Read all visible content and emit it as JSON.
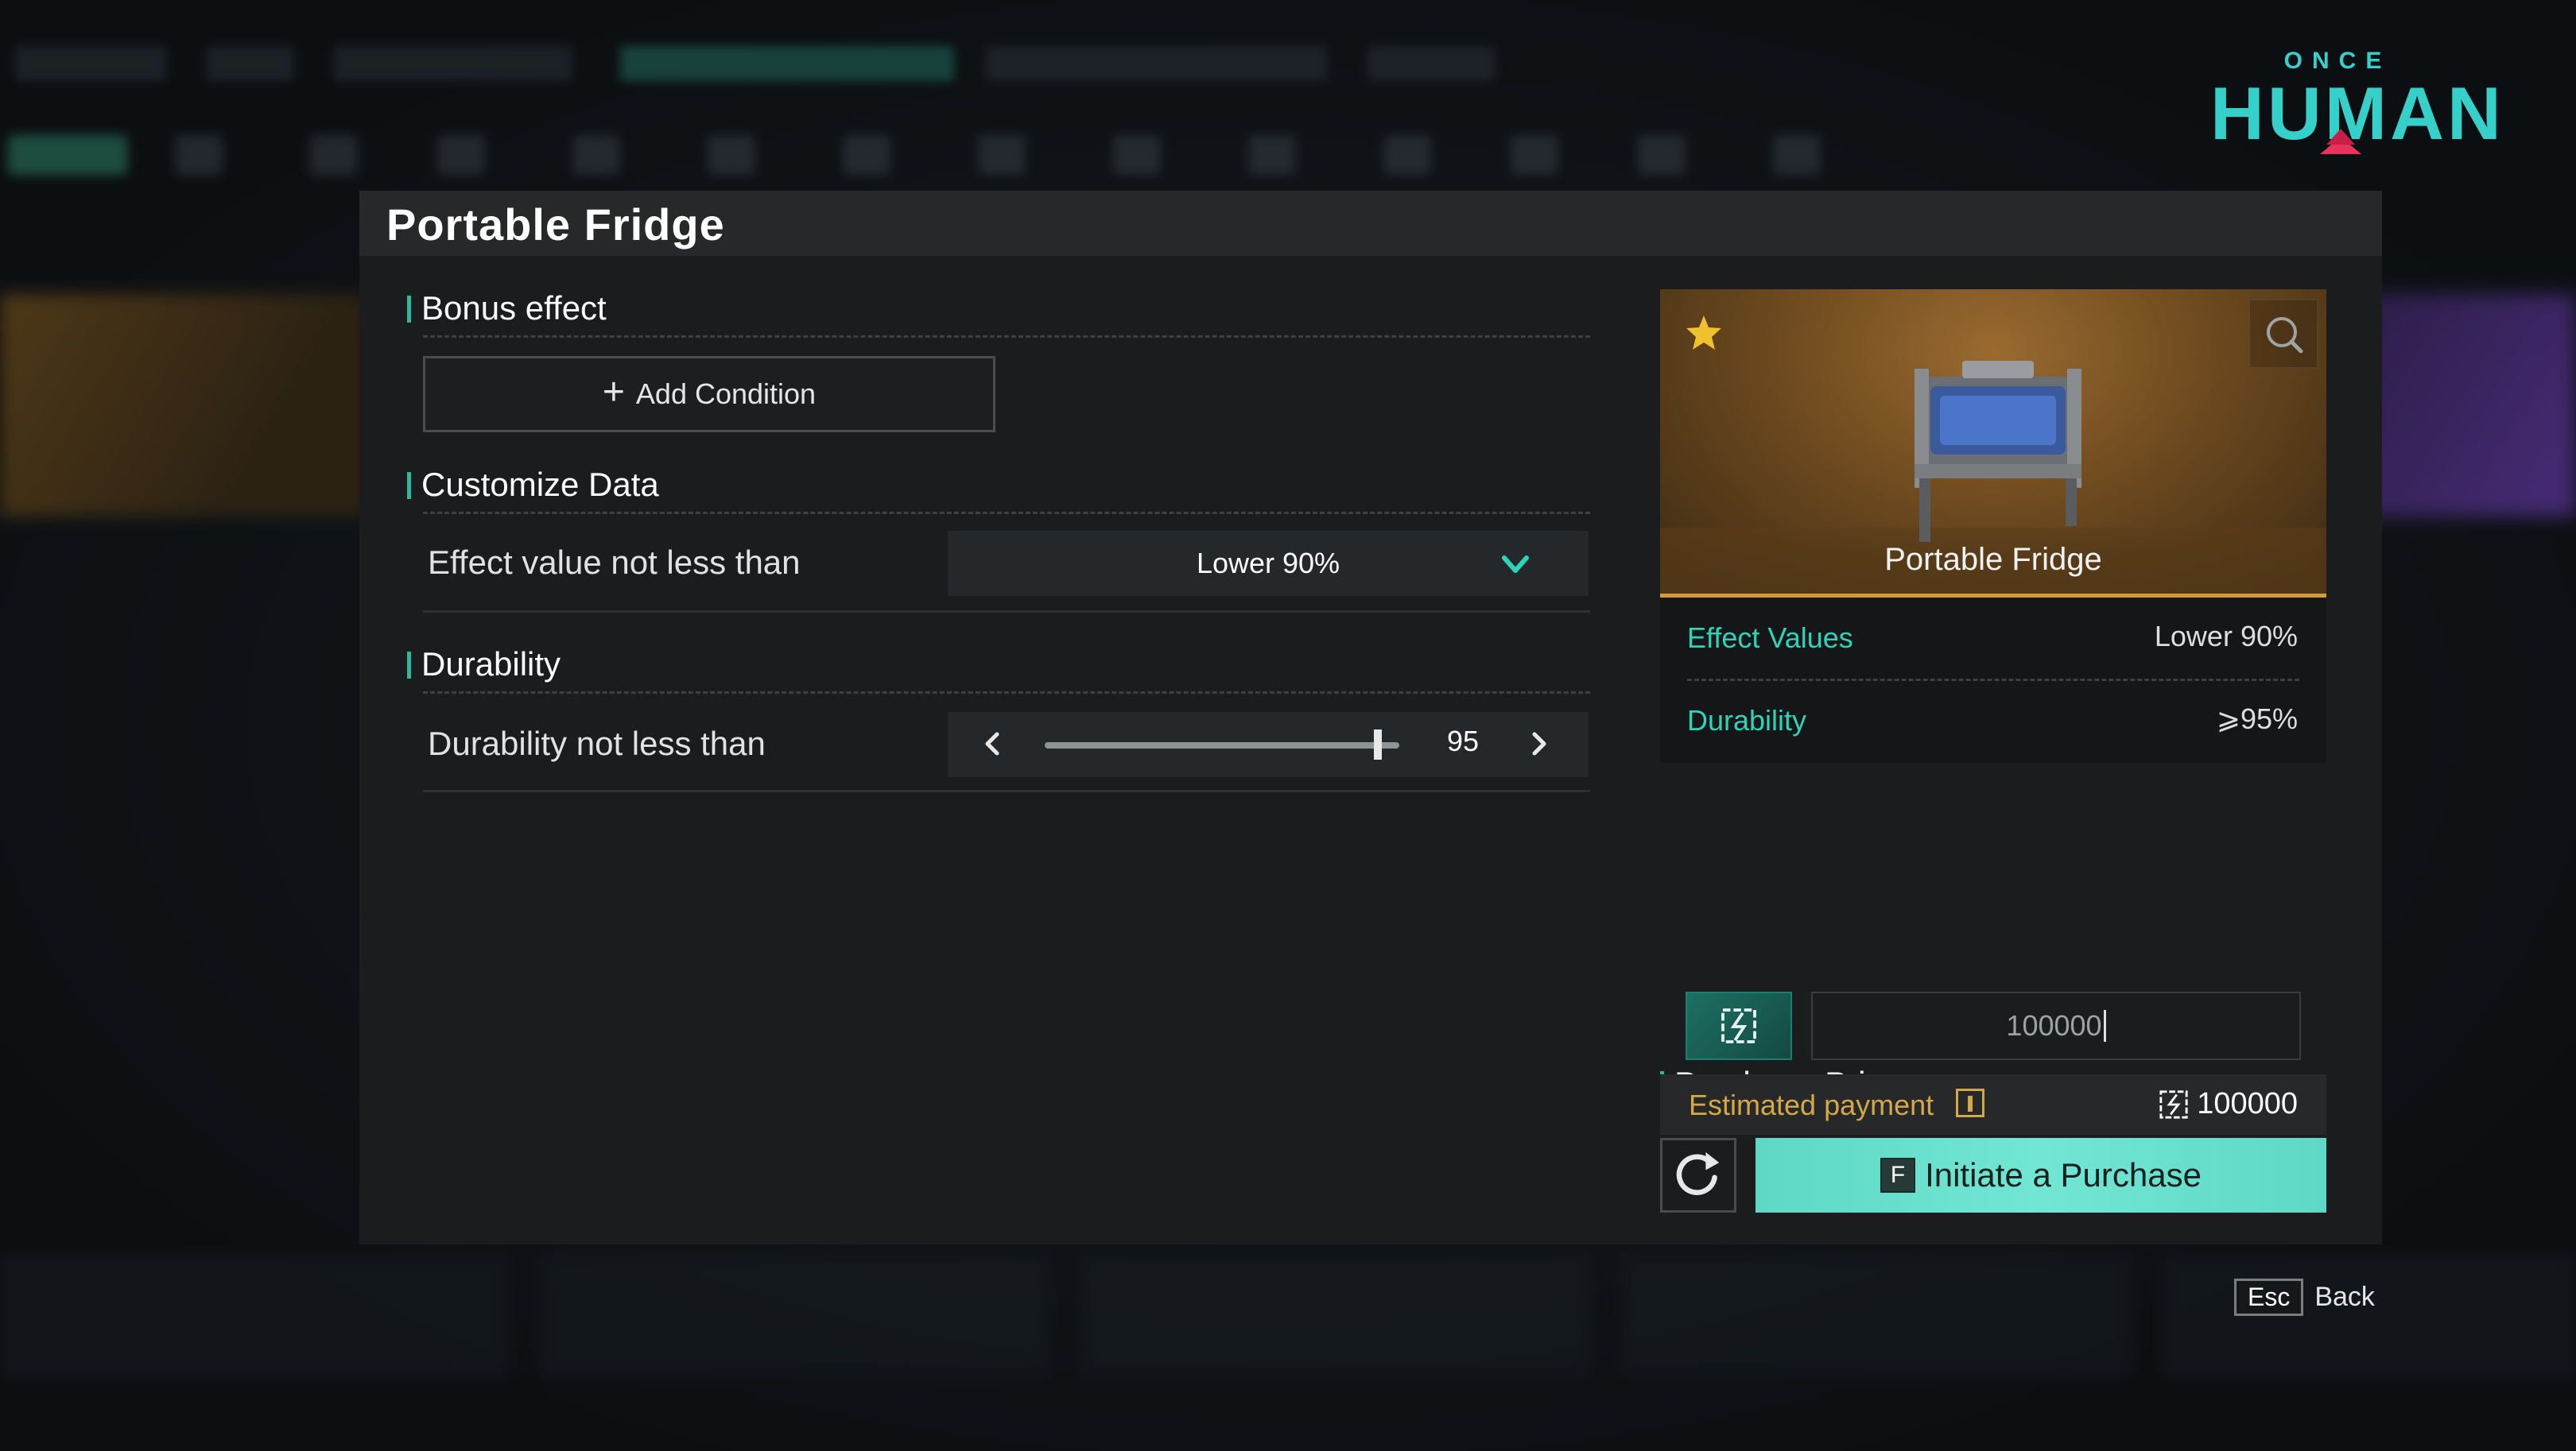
{
  "app": {
    "logo_top": "ONCE",
    "logo_main": "HUMAN"
  },
  "dialog": {
    "title": "Portable Fridge",
    "bonus_effect": {
      "heading": "Bonus effect",
      "add_condition_label": "Add Condition"
    },
    "customize": {
      "heading": "Customize Data",
      "effect_label": "Effect value not less than",
      "effect_selected": "Lower 90%"
    },
    "durability": {
      "heading": "Durability",
      "label": "Durability not less than",
      "value": "95",
      "level": 95
    },
    "item": {
      "name": "Portable Fridge",
      "favorite": true,
      "stats": [
        {
          "key": "Effect Values",
          "value": "Lower 90%"
        },
        {
          "key": "Durability",
          "value": "⩾95%"
        }
      ]
    },
    "purchase": {
      "heading": "Purchase Price",
      "price_value": "100000",
      "estimated_label": "Estimated payment",
      "estimated_value": "100000",
      "button_key": "F",
      "button_label": "Initiate a Purchase"
    }
  },
  "footer": {
    "esc_key": "Esc",
    "back_label": "Back"
  },
  "colors": {
    "accent": "#2fd3b8",
    "accent_button": "#66dcca",
    "gold": "#d4a846",
    "panel": "#1a1c1e"
  },
  "icons": [
    "plus-icon",
    "chevron-down-icon",
    "chevron-left-icon",
    "chevron-right-icon",
    "star-icon",
    "search-icon",
    "currency-icon",
    "info-icon",
    "refresh-icon"
  ]
}
